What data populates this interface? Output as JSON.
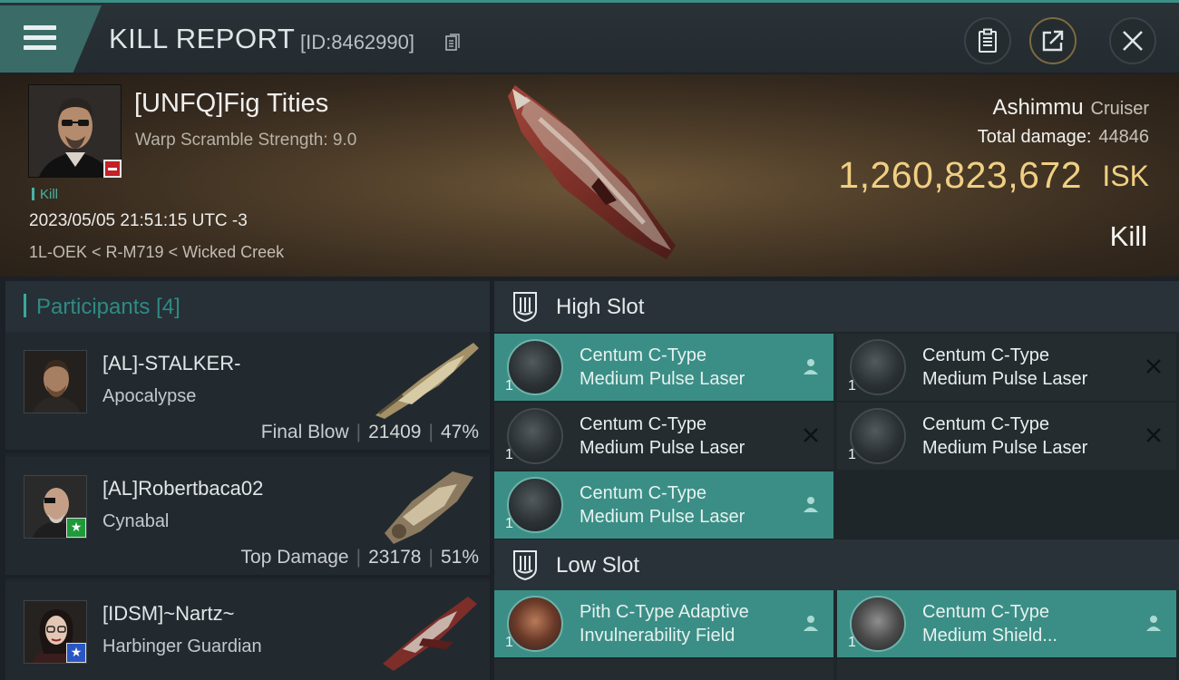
{
  "header": {
    "title": "KILL REPORT",
    "report_id": "[ID:8462990]"
  },
  "victim": {
    "name": "[UNFQ]Fig Tities",
    "warp_scramble": "Warp Scramble Strength: 9.0",
    "tag": "Kill",
    "timestamp": "2023/05/05 21:51:15 UTC -3",
    "location": "1L-OEK < R-M719 < Wicked Creek",
    "ship": "Ashimmu",
    "ship_class": "Cruiser",
    "total_damage_label": "Total damage:",
    "total_damage": "44846",
    "isk_value": "1,260,823,672",
    "isk_label": "ISK",
    "result": "Kill"
  },
  "participants": {
    "title": "Participants [4]",
    "items": [
      {
        "name": "[AL]-STALKER-",
        "ship": "Apocalypse",
        "label": "Final Blow",
        "damage": "21409",
        "percent": "47%",
        "badge": ""
      },
      {
        "name": "[AL]Robertbaca02",
        "ship": "Cynabal",
        "label": "Top Damage",
        "damage": "23178",
        "percent": "51%",
        "badge": "green-star"
      },
      {
        "name": "[IDSM]~Nartz~",
        "ship": "Harbinger Guardian",
        "label": "",
        "damage": "",
        "percent": "",
        "badge": "blue-star"
      }
    ]
  },
  "fitting": {
    "high_slot_title": "High Slot",
    "low_slot_title": "Low Slot",
    "high_slots": [
      {
        "name_line1": "Centum C-Type",
        "name_line2": "Medium Pulse Laser",
        "qty": "1",
        "state": "dropped"
      },
      {
        "name_line1": "Centum C-Type",
        "name_line2": "Medium Pulse Laser",
        "qty": "1",
        "state": "destroyed"
      },
      {
        "name_line1": "Centum C-Type",
        "name_line2": "Medium Pulse Laser",
        "qty": "1",
        "state": "destroyed"
      },
      {
        "name_line1": "Centum C-Type",
        "name_line2": "Medium Pulse Laser",
        "qty": "1",
        "state": "destroyed"
      },
      {
        "name_line1": "Centum C-Type",
        "name_line2": "Medium Pulse Laser",
        "qty": "1",
        "state": "dropped"
      }
    ],
    "low_slots": [
      {
        "name_line1": "Pith C-Type Adaptive",
        "name_line2": "Invulnerability Field",
        "qty": "1",
        "state": "dropped"
      },
      {
        "name_line1": "Centum C-Type",
        "name_line2": "Medium Shield...",
        "qty": "1",
        "state": "dropped"
      }
    ]
  },
  "colors": {
    "accent": "#3b8e86",
    "isk": "#f0cf83",
    "badge_red": "#c42026",
    "star_green": "#1e9a3a",
    "star_blue": "#2a56c4"
  }
}
